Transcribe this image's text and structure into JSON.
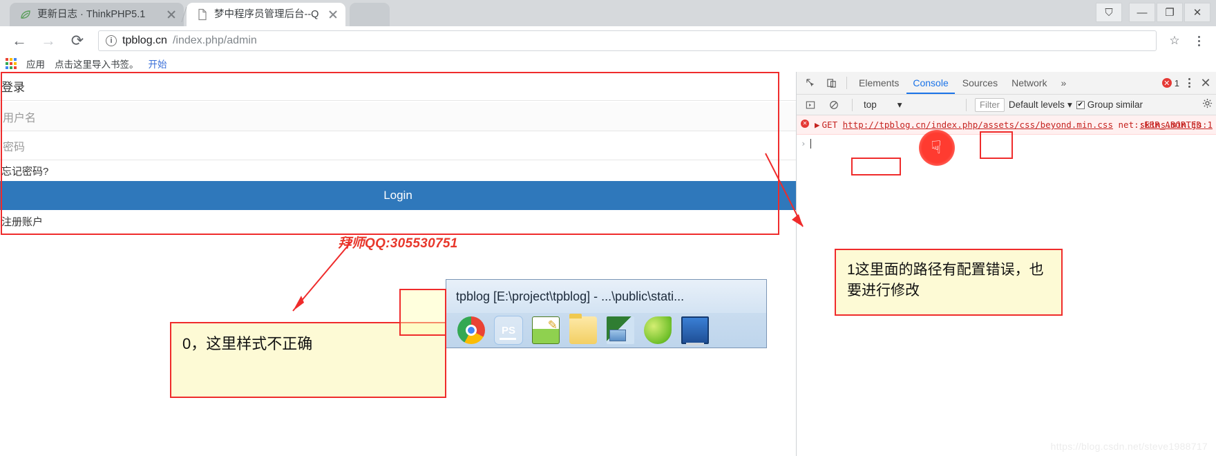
{
  "browser": {
    "tabs": [
      {
        "title": "更新日志 · ThinkPHP5.1",
        "favicon": "leaf-icon",
        "active": false
      },
      {
        "title": "梦中程序员管理后台--Q",
        "favicon": "page-icon",
        "active": true
      }
    ],
    "window_controls": {
      "profile": "⛉",
      "minimize": "—",
      "restore": "❐",
      "close": "✕"
    },
    "toolbar": {
      "back": "←",
      "forward": "→",
      "reload": "⟳",
      "info_icon": "i",
      "url_host": "tpblog.cn",
      "url_path": "/index.php/admin",
      "star": "☆",
      "menu": "kebab-menu-icon"
    },
    "bookmarks": {
      "apps_label": "应用",
      "import_hint": "点击这里导入书签。",
      "start_link": "开始"
    }
  },
  "page": {
    "heading": "登录",
    "username_placeholder": "用户名",
    "password_placeholder": "密码",
    "forgot_password": "忘记密码?",
    "login_button": "Login",
    "register_link": "注册账户",
    "qq_text": "拜师QQ:305530751"
  },
  "taskbar_snippet": {
    "window_title": "tpblog [E:\\project\\tpblog] - ...\\public\\stati...",
    "icons": [
      {
        "name": "chrome-icon",
        "label": "Chrome"
      },
      {
        "name": "phpstorm-icon",
        "label": "PS"
      },
      {
        "name": "notepadpp-icon",
        "label": "Notepad++"
      },
      {
        "name": "folder-icon",
        "label": "Folder"
      },
      {
        "name": "remote-desktop-icon",
        "label": "Remote Desktop"
      },
      {
        "name": "leaf-app-icon",
        "label": "Leaf App"
      },
      {
        "name": "monitor-icon",
        "label": "Monitor"
      }
    ]
  },
  "annotations": [
    {
      "id": "note-0",
      "text": "0，这里样式不正确"
    },
    {
      "id": "note-1",
      "text": "1这里面的路径有配置错误，也要进行修改"
    }
  ],
  "devtools": {
    "tabs": [
      {
        "label": "Elements",
        "active": false
      },
      {
        "label": "Console",
        "active": true
      },
      {
        "label": "Sources",
        "active": false
      },
      {
        "label": "Network",
        "active": false
      }
    ],
    "overflow": "»",
    "error_count": "1",
    "error_dot": "✕",
    "kebab": "kebab-menu-icon",
    "close": "✕",
    "inspect_icon": "inspect-element-icon",
    "device_icon": "device-toolbar-icon",
    "filterbar": {
      "sidebar_toggle": "▶",
      "clear_console": "⃠",
      "context": "top",
      "context_caret": "▾",
      "filter_placeholder": "Filter",
      "levels_label": "Default levels",
      "levels_caret": "▾",
      "group_similar_label": "Group similar",
      "group_similar_checked": "✔",
      "settings_icon": "gear-icon"
    },
    "console": {
      "error_method": "GET",
      "error_url": "http://tpblog.cn/index.php/assets/css/beyond.min.css",
      "error_status": "net::ERR_ABORTED",
      "error_source": "skins.min.js:1",
      "expand_caret": "▶",
      "prompt_chevron": "›"
    }
  },
  "watermark": "https://blog.csdn.net/steve1988717",
  "colors": {
    "accent_blue": "#2f78bb",
    "annotation_red": "#ef2b2b",
    "note_bg": "#fdfad5",
    "error_red": "#c5221f",
    "devtools_active": "#1a73e8"
  }
}
